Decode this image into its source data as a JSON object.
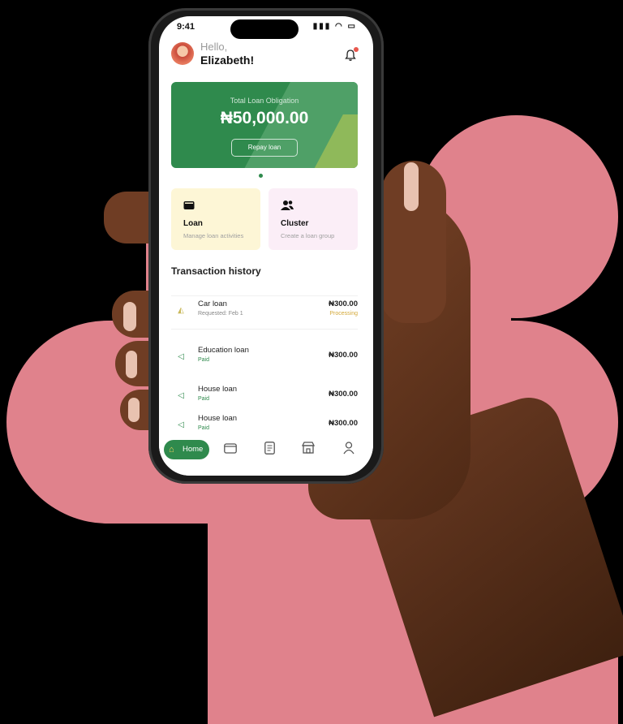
{
  "status_bar": {
    "time": "9:41",
    "icons": "▮▮▮ ◠ ▭"
  },
  "header": {
    "greeting": "Hello,",
    "name": "Elizabeth!"
  },
  "loan_card": {
    "label": "Total Loan Obligation",
    "amount": "₦50,000.00",
    "button": "Repay loan"
  },
  "tiles": [
    {
      "title": "Loan",
      "subtitle": "Manage loan activities",
      "icon": "wallet-icon"
    },
    {
      "title": "Cluster",
      "subtitle": "Create a loan group",
      "icon": "group-icon"
    }
  ],
  "transactions": {
    "title": "Transaction history",
    "items": [
      {
        "name": "Car loan",
        "sub": "Requested: Feb 1",
        "amount": "₦300.00",
        "status": "Processing"
      },
      {
        "name": "Education loan",
        "sub": "Paid",
        "amount": "₦300.00",
        "status": ""
      },
      {
        "name": "House loan",
        "sub": "Paid",
        "amount": "₦300.00",
        "status": ""
      },
      {
        "name": "House loan",
        "sub": "Paid",
        "amount": "₦300.00",
        "status": ""
      }
    ]
  },
  "nav": {
    "home": "Home"
  },
  "colors": {
    "accent": "#2f8a4d",
    "background_shape": "#e0828c",
    "processing": "#d4a93a"
  }
}
